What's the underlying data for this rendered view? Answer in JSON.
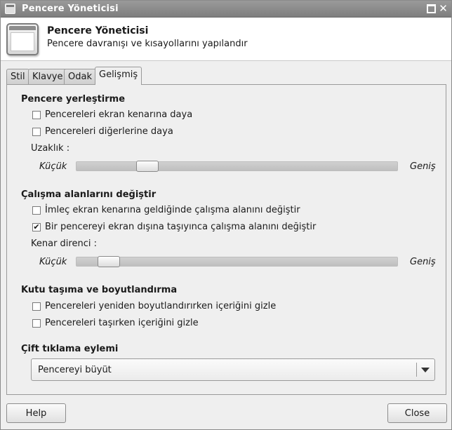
{
  "window": {
    "title": "Pencere Yöneticisi"
  },
  "header": {
    "title": "Pencere Yöneticisi",
    "subtitle": "Pencere davranışı ve kısayollarını yapılandır"
  },
  "tabs": [
    {
      "label": "Stil",
      "active": false
    },
    {
      "label": "Klavye",
      "active": false
    },
    {
      "label": "Odak",
      "active": false
    },
    {
      "label": "Gelişmiş",
      "active": true
    }
  ],
  "placement": {
    "title": "Pencere yerleştirme",
    "snap_screen": {
      "label": "Pencereleri ekran kenarına daya",
      "checked": false
    },
    "snap_windows": {
      "label": "Pencereleri diğerlerine daya",
      "checked": false
    },
    "distance_label": "Uzaklık :",
    "min_label": "Küçük",
    "max_label": "Geniş",
    "distance_value": 0.2
  },
  "workspaces": {
    "title": "Çalışma alanlarını değiştir",
    "wrap_pointer": {
      "label": "İmleç ekran kenarına geldiğinde çalışma alanını değiştir",
      "checked": false
    },
    "wrap_window": {
      "label": "Bir pencereyi ekran dışına taşıyınca çalışma alanını değiştir",
      "checked": true,
      "mark": "✔"
    },
    "resistance_label": "Kenar direnci :",
    "min_label": "Küçük",
    "max_label": "Geniş",
    "resistance_value": 0.07
  },
  "box": {
    "title": "Kutu taşıma ve boyutlandırma",
    "hide_resize": {
      "label": "Pencereleri yeniden boyutlandırırken içeriğini gizle",
      "checked": false
    },
    "hide_move": {
      "label": "Pencereleri taşırken içeriğini gizle",
      "checked": false
    }
  },
  "double_click": {
    "title": "Çift tıklama eylemi",
    "selected": "Pencereyi büyüt"
  },
  "buttons": {
    "help": "Help",
    "close": "Close"
  },
  "icons": {
    "app": "window-manager-icon",
    "maximize": "maximize-icon",
    "close": "close-icon",
    "dropdown": "chevron-down-icon"
  },
  "colors": {
    "titlebar": "#8a8a8a",
    "background": "#efefef",
    "header": "#ffffff"
  }
}
